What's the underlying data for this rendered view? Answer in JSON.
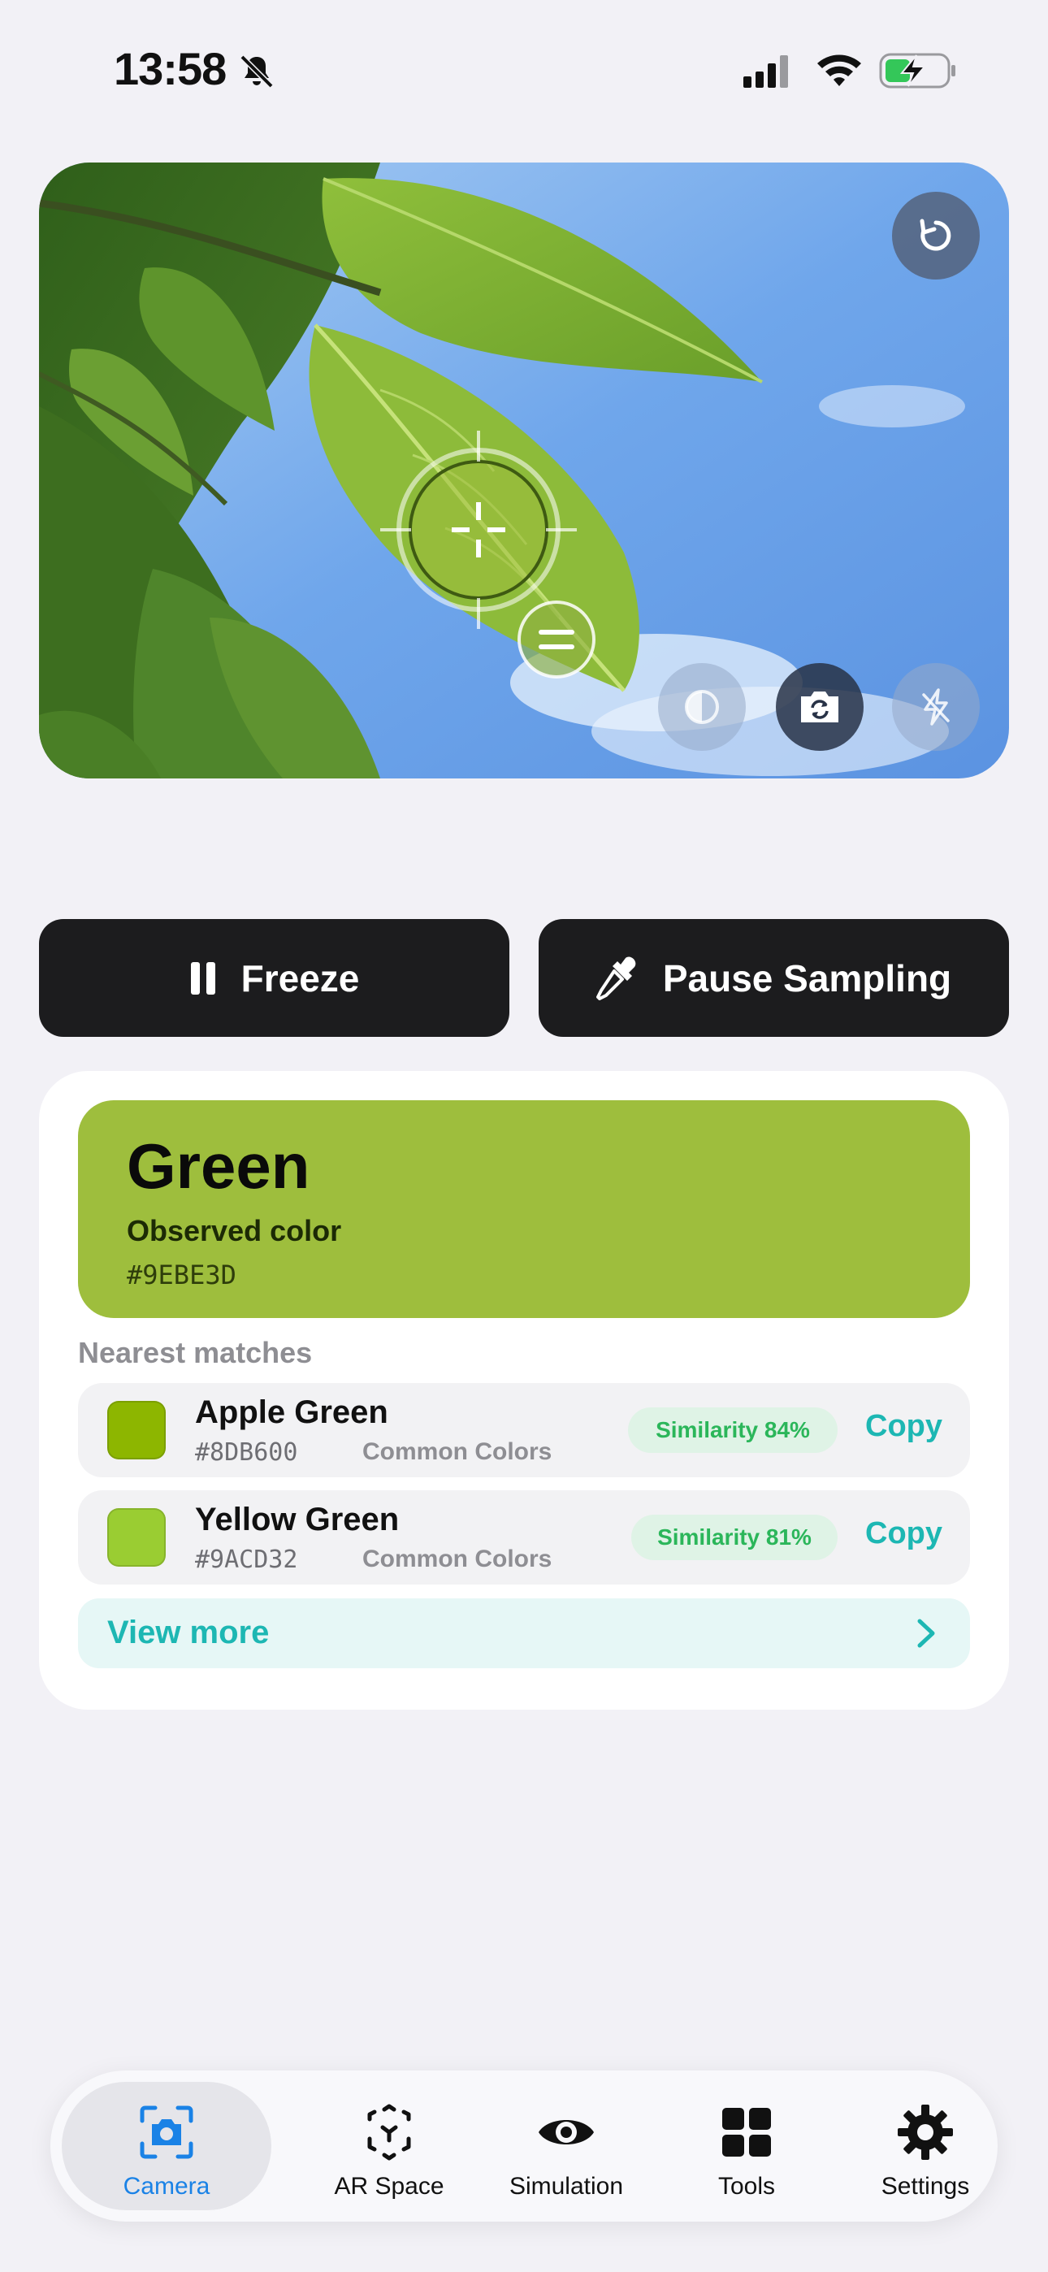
{
  "status_bar": {
    "time": "13:58",
    "icons": [
      "bell-slash-icon",
      "cellular-signal-icon",
      "wifi-icon",
      "battery-charging-icon"
    ]
  },
  "camera": {
    "controls": [
      "reset-rotation-icon",
      "contrast-icon",
      "switch-camera-icon",
      "flash-off-icon"
    ],
    "sample_color": "#9EBE3D"
  },
  "actions": {
    "freeze_label": "Freeze",
    "pause_label": "Pause Sampling"
  },
  "result": {
    "color_name": "Green",
    "observed_label": "Observed color",
    "observed_hex": "#9EBE3D",
    "swatch_color": "#9EBE3D",
    "nearest_label": "Nearest matches",
    "matches": [
      {
        "name": "Apple Green",
        "hex": "#8DB600",
        "source": "Common Colors",
        "similarity": "Similarity 84%",
        "copy": "Copy",
        "color": "#8DB600"
      },
      {
        "name": "Yellow Green",
        "hex": "#9ACD32",
        "source": "Common Colors",
        "similarity": "Similarity 81%",
        "copy": "Copy",
        "color": "#9ACD32"
      }
    ],
    "view_more": "View more"
  },
  "tabbar": {
    "active": "Camera",
    "tabs": [
      {
        "label": "Camera",
        "icon": "camera-icon"
      },
      {
        "label": "AR Space",
        "icon": "ar-cube-icon"
      },
      {
        "label": "Simulation",
        "icon": "eye-icon"
      },
      {
        "label": "Tools",
        "icon": "grid-icon"
      },
      {
        "label": "Settings",
        "icon": "gear-icon"
      }
    ]
  },
  "colors": {
    "accent_teal": "#1DB7B3",
    "accent_blue": "#1A82E6",
    "similarity_green": "#2BB65A"
  }
}
